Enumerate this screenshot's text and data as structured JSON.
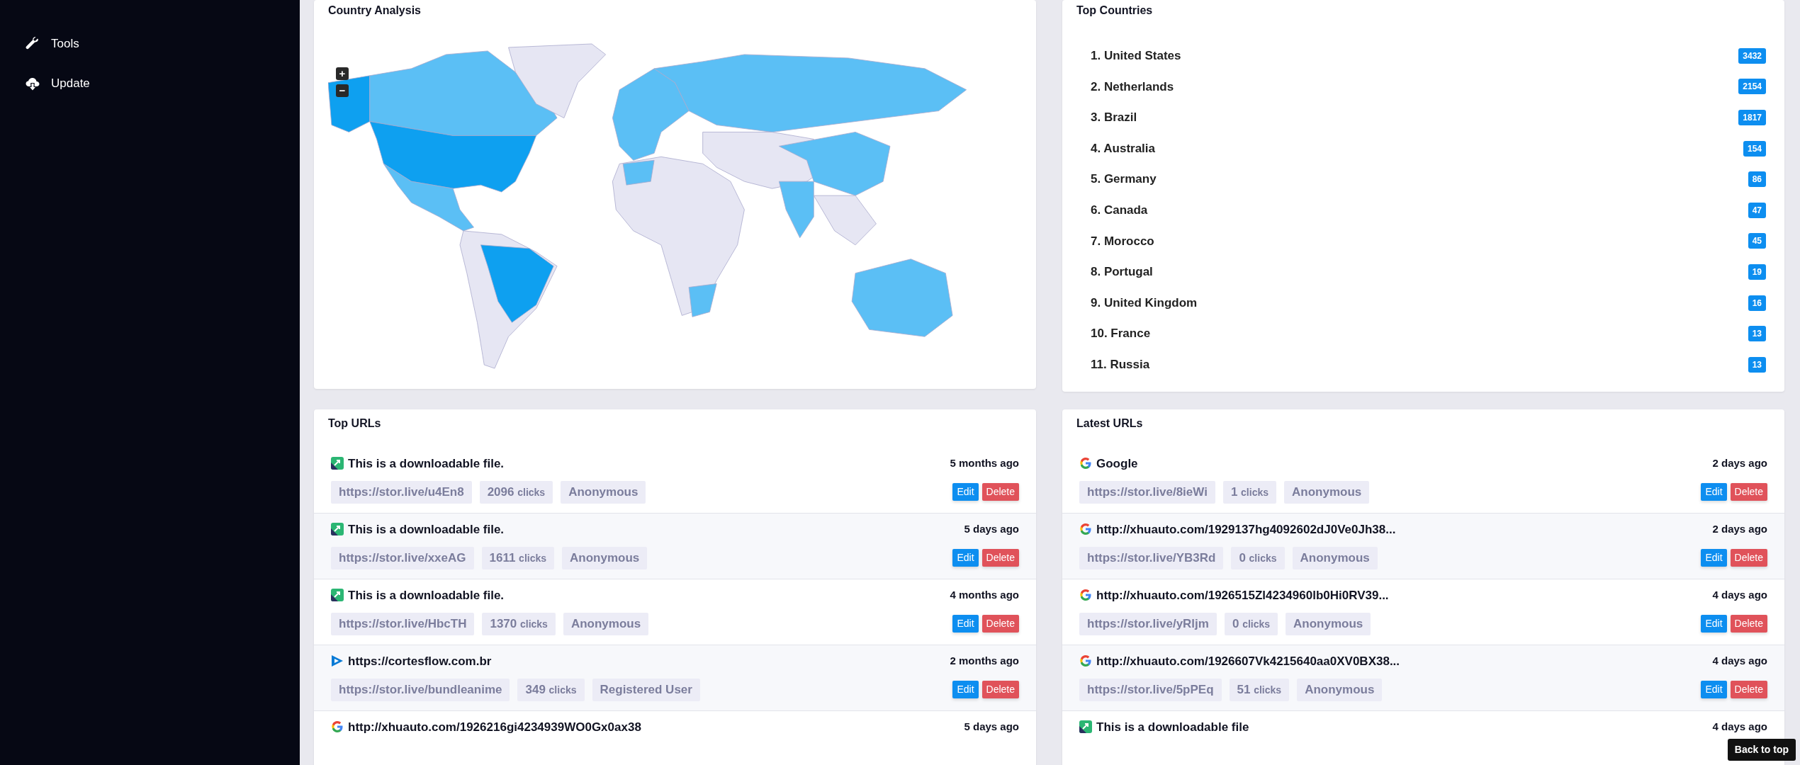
{
  "sidebar": {
    "items": [
      {
        "kind": "wrench",
        "label": "Tools"
      },
      {
        "kind": "cloud-download",
        "label": "Update"
      }
    ]
  },
  "country_analysis": {
    "title": "Country Analysis",
    "zoom_controls": [
      "+",
      "−"
    ]
  },
  "top_countries": {
    "title": "Top Countries",
    "items": [
      {
        "rank": "1.",
        "name": "United States",
        "count": "3432"
      },
      {
        "rank": "2.",
        "name": "Netherlands",
        "count": "2154"
      },
      {
        "rank": "3.",
        "name": "Brazil",
        "count": "1817"
      },
      {
        "rank": "4.",
        "name": "Australia",
        "count": "154"
      },
      {
        "rank": "5.",
        "name": "Germany",
        "count": "86"
      },
      {
        "rank": "6.",
        "name": "Canada",
        "count": "47"
      },
      {
        "rank": "7.",
        "name": "Morocco",
        "count": "45"
      },
      {
        "rank": "8.",
        "name": "Portugal",
        "count": "19"
      },
      {
        "rank": "9.",
        "name": "United Kingdom",
        "count": "16"
      },
      {
        "rank": "10.",
        "name": "France",
        "count": "13"
      },
      {
        "rank": "11.",
        "name": "Russia",
        "count": "13"
      }
    ]
  },
  "top_urls": {
    "title": "Top URLs",
    "rows": [
      {
        "kind": "file",
        "title": "This is a downloadable file.",
        "time": "5 months ago",
        "short_url": "https://stor.live/u4En8",
        "clicks": "2096",
        "clicks_label": "clicks",
        "user": "Anonymous",
        "actions": [
          "Edit",
          "Delete"
        ]
      },
      {
        "kind": "file",
        "title": "This is a downloadable file.",
        "time": "5 days ago",
        "short_url": "https://stor.live/xxeAG",
        "clicks": "1611",
        "clicks_label": "clicks",
        "user": "Anonymous",
        "actions": [
          "Edit",
          "Delete"
        ]
      },
      {
        "kind": "file",
        "title": "This is a downloadable file.",
        "time": "4 months ago",
        "short_url": "https://stor.live/HbcTH",
        "clicks": "1370",
        "clicks_label": "clicks",
        "user": "Anonymous",
        "actions": [
          "Edit",
          "Delete"
        ]
      },
      {
        "kind": "play",
        "title": "https://cortesflow.com.br",
        "time": "2 months ago",
        "short_url": "https://stor.live/bundleanime",
        "clicks": "349",
        "clicks_label": "clicks",
        "user": "Registered User",
        "actions": [
          "Edit",
          "Delete"
        ]
      },
      {
        "kind": "google",
        "title": "http://xhuauto.com/1926216gi4234939WO0Gx0ax38",
        "time": "5 days ago"
      }
    ]
  },
  "latest_urls": {
    "title": "Latest URLs",
    "rows": [
      {
        "kind": "google",
        "title": "Google",
        "time": "2 days ago",
        "short_url": "https://stor.live/8ieWi",
        "clicks": "1",
        "clicks_label": "clicks",
        "user": "Anonymous",
        "actions": [
          "Edit",
          "Delete"
        ]
      },
      {
        "kind": "google",
        "title": "http://xhuauto.com/1929137hg4092602dJ0Ve0Jh38...",
        "time": "2 days ago",
        "short_url": "https://stor.live/YB3Rd",
        "clicks": "0",
        "clicks_label": "clicks",
        "user": "Anonymous",
        "actions": [
          "Edit",
          "Delete"
        ]
      },
      {
        "kind": "google",
        "title": "http://xhuauto.com/1926515Zl4234960lb0Hi0RV39...",
        "time": "4 days ago",
        "short_url": "https://stor.live/yRljm",
        "clicks": "0",
        "clicks_label": "clicks",
        "user": "Anonymous",
        "actions": [
          "Edit",
          "Delete"
        ]
      },
      {
        "kind": "google",
        "title": "http://xhuauto.com/1926607Vk4215640aa0XV0BX38...",
        "time": "4 days ago",
        "short_url": "https://stor.live/5pPEq",
        "clicks": "51",
        "clicks_label": "clicks",
        "user": "Anonymous",
        "actions": [
          "Edit",
          "Delete"
        ]
      },
      {
        "kind": "file",
        "title": "This is a downloadable file",
        "time": "4 days ago"
      }
    ]
  },
  "back_to_top": "Back to top"
}
